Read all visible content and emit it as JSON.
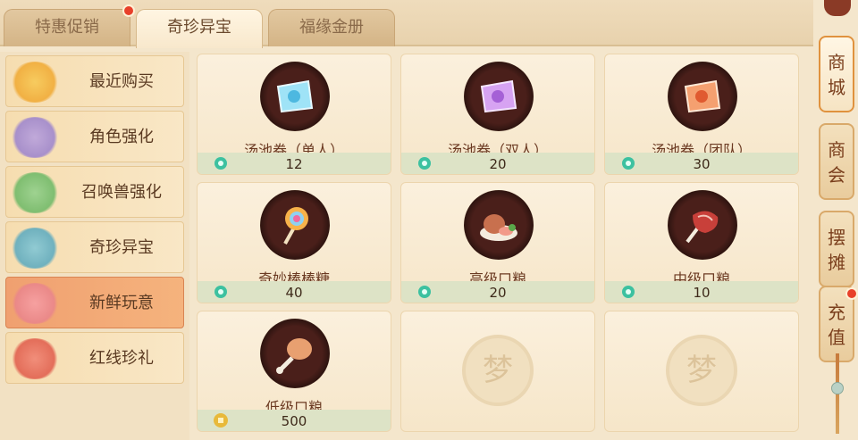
{
  "top_tabs": [
    {
      "label": "特惠促销",
      "active": false,
      "badge": true
    },
    {
      "label": "奇珍异宝",
      "active": true,
      "badge": false
    },
    {
      "label": "福缘金册",
      "active": false,
      "badge": false
    }
  ],
  "menu": [
    {
      "label": "最近购买",
      "active": false
    },
    {
      "label": "角色强化",
      "active": false
    },
    {
      "label": "召唤兽强化",
      "active": false
    },
    {
      "label": "奇珍异宝",
      "active": false
    },
    {
      "label": "新鲜玩意",
      "active": true
    },
    {
      "label": "红线珍礼",
      "active": false
    }
  ],
  "items": [
    {
      "name": "汤池券（单人）",
      "price": "12",
      "currency": "jade-currency-icon",
      "icon": "bath-ticket-single-icon",
      "color": "#7fd3f0"
    },
    {
      "name": "汤池券（双人）",
      "price": "20",
      "currency": "jade-currency-icon",
      "icon": "bath-ticket-double-icon",
      "color": "#c98ae8"
    },
    {
      "name": "汤池券（团队）",
      "price": "30",
      "currency": "jade-currency-icon",
      "icon": "bath-ticket-team-icon",
      "color": "#f09060"
    },
    {
      "name": "奇妙棒棒糖",
      "price": "40",
      "currency": "jade-currency-icon",
      "icon": "lollipop-icon",
      "color": "#f2a04a"
    },
    {
      "name": "高级口粮",
      "price": "20",
      "currency": "jade-currency-icon",
      "icon": "ham-platter-icon",
      "color": "#d97a5a"
    },
    {
      "name": "中级口粮",
      "price": "10",
      "currency": "jade-currency-icon",
      "icon": "meat-rib-icon",
      "color": "#c84a3a"
    },
    {
      "name": "低级口粮",
      "price": "500",
      "currency": "gold-coin-icon",
      "icon": "drumstick-icon",
      "color": "#e0a070"
    }
  ],
  "empty_slots": 2,
  "empty_seal": "梦",
  "right_tabs": [
    {
      "label": "商城",
      "active": true,
      "badge": false
    },
    {
      "label": "商会",
      "active": false,
      "badge": false
    },
    {
      "label": "摆摊",
      "active": false,
      "badge": false
    },
    {
      "label": "充值",
      "active": false,
      "badge": true
    }
  ],
  "colors": {
    "accent": "#e8402a",
    "jade": "#3cc1a0",
    "gold": "#e8b93a"
  }
}
